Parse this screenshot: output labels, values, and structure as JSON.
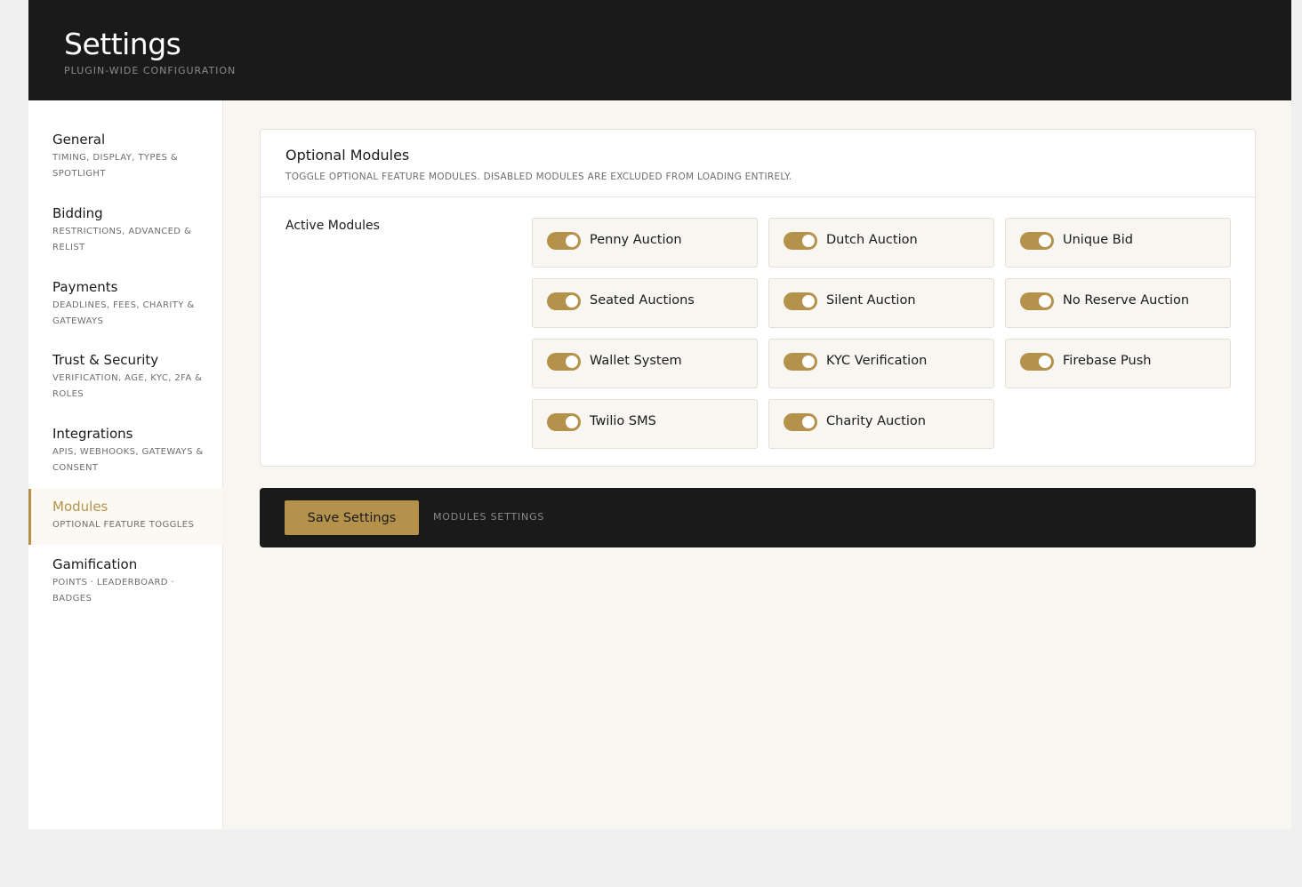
{
  "header": {
    "title": "Settings",
    "subtitle": "Plugin-wide configuration"
  },
  "sidebar": {
    "items": [
      {
        "label": "General",
        "desc": "Timing, display, types & spotlight",
        "active": false
      },
      {
        "label": "Bidding",
        "desc": "Restrictions, advanced & relist",
        "active": false
      },
      {
        "label": "Payments",
        "desc": "Deadlines, fees, charity & gateways",
        "active": false
      },
      {
        "label": "Trust & Security",
        "desc": "Verification, age, KYC, 2FA & roles",
        "active": false
      },
      {
        "label": "Integrations",
        "desc": "APIs, webhooks, gateways & consent",
        "active": false
      },
      {
        "label": "Modules",
        "desc": "Optional feature toggles",
        "active": true
      },
      {
        "label": "Gamification",
        "desc": "Points · leaderboard · badges",
        "active": false
      }
    ]
  },
  "panel": {
    "title": "Optional Modules",
    "description": "Toggle optional feature modules. Disabled modules are excluded from loading entirely.",
    "field_label": "Active Modules",
    "modules": [
      {
        "label": "Penny Auction",
        "enabled": true
      },
      {
        "label": "Dutch Auction",
        "enabled": true
      },
      {
        "label": "Unique Bid",
        "enabled": true
      },
      {
        "label": "Seated Auctions",
        "enabled": true
      },
      {
        "label": "Silent Auction",
        "enabled": true
      },
      {
        "label": "No Reserve Auction",
        "enabled": true
      },
      {
        "label": "Wallet System",
        "enabled": true
      },
      {
        "label": "KYC Verification",
        "enabled": true
      },
      {
        "label": "Firebase Push",
        "enabled": true
      },
      {
        "label": "Twilio SMS",
        "enabled": true
      },
      {
        "label": "Charity Auction",
        "enabled": true
      }
    ]
  },
  "footer": {
    "save_label": "Save Settings",
    "hint": "Modules settings"
  },
  "colors": {
    "accent": "#b5924b",
    "dark": "#1a1a1a",
    "background": "#f8f6f1"
  }
}
